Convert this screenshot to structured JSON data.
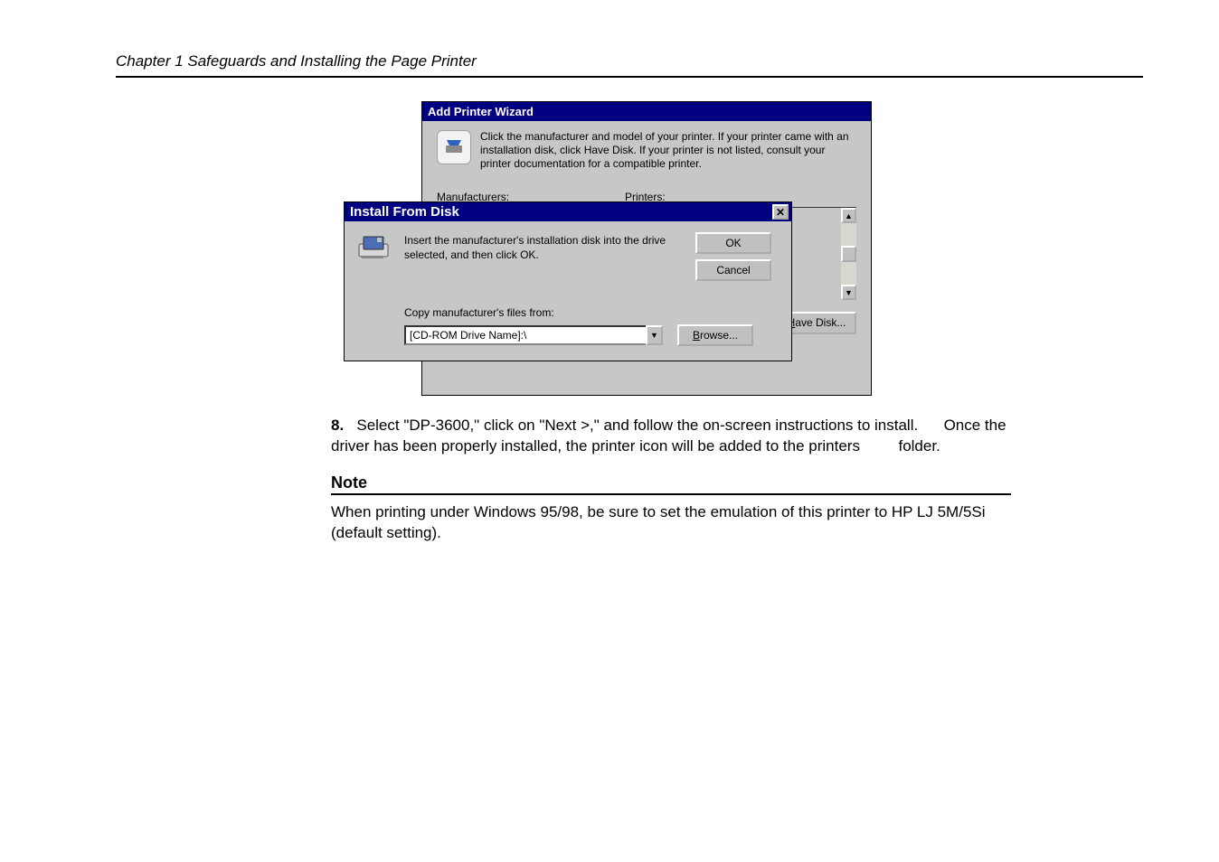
{
  "chapter_line": "Chapter 1 Safeguards and Installing the Page Printer",
  "wizard": {
    "title": "Add Printer Wizard",
    "info": "Click the manufacturer and model of your printer. If your printer came with an installation disk, click Have Disk. If your printer is not listed, consult your printer documentation for a compatible printer.",
    "manufacturers_label": "Manufacturers:",
    "printers_label": "Printers:",
    "have_disk_label": "Have Disk..."
  },
  "ifd": {
    "title": "Install From Disk",
    "text": "Insert the manufacturer's installation disk into the drive selected, and then click OK.",
    "ok_label": "OK",
    "cancel_label": "Cancel",
    "copy_label": "Copy manufacturer's files from:",
    "path_value": "[CD-ROM Drive Name]:\\",
    "browse_label": "Browse..."
  },
  "step8_num": "8.",
  "step8_a": "Select \"DP-3600,\" click on \"Next >,\" and follow the on-screen instructions to install.",
  "step8_b": "Once the driver has been properly installed, the printer icon will be added to the printers",
  "step8_c": "folder.",
  "note_heading": "Note",
  "note_body": "When printing under Windows 95/98, be sure to set the emulation of this printer to HP LJ 5M/5Si (default setting)."
}
